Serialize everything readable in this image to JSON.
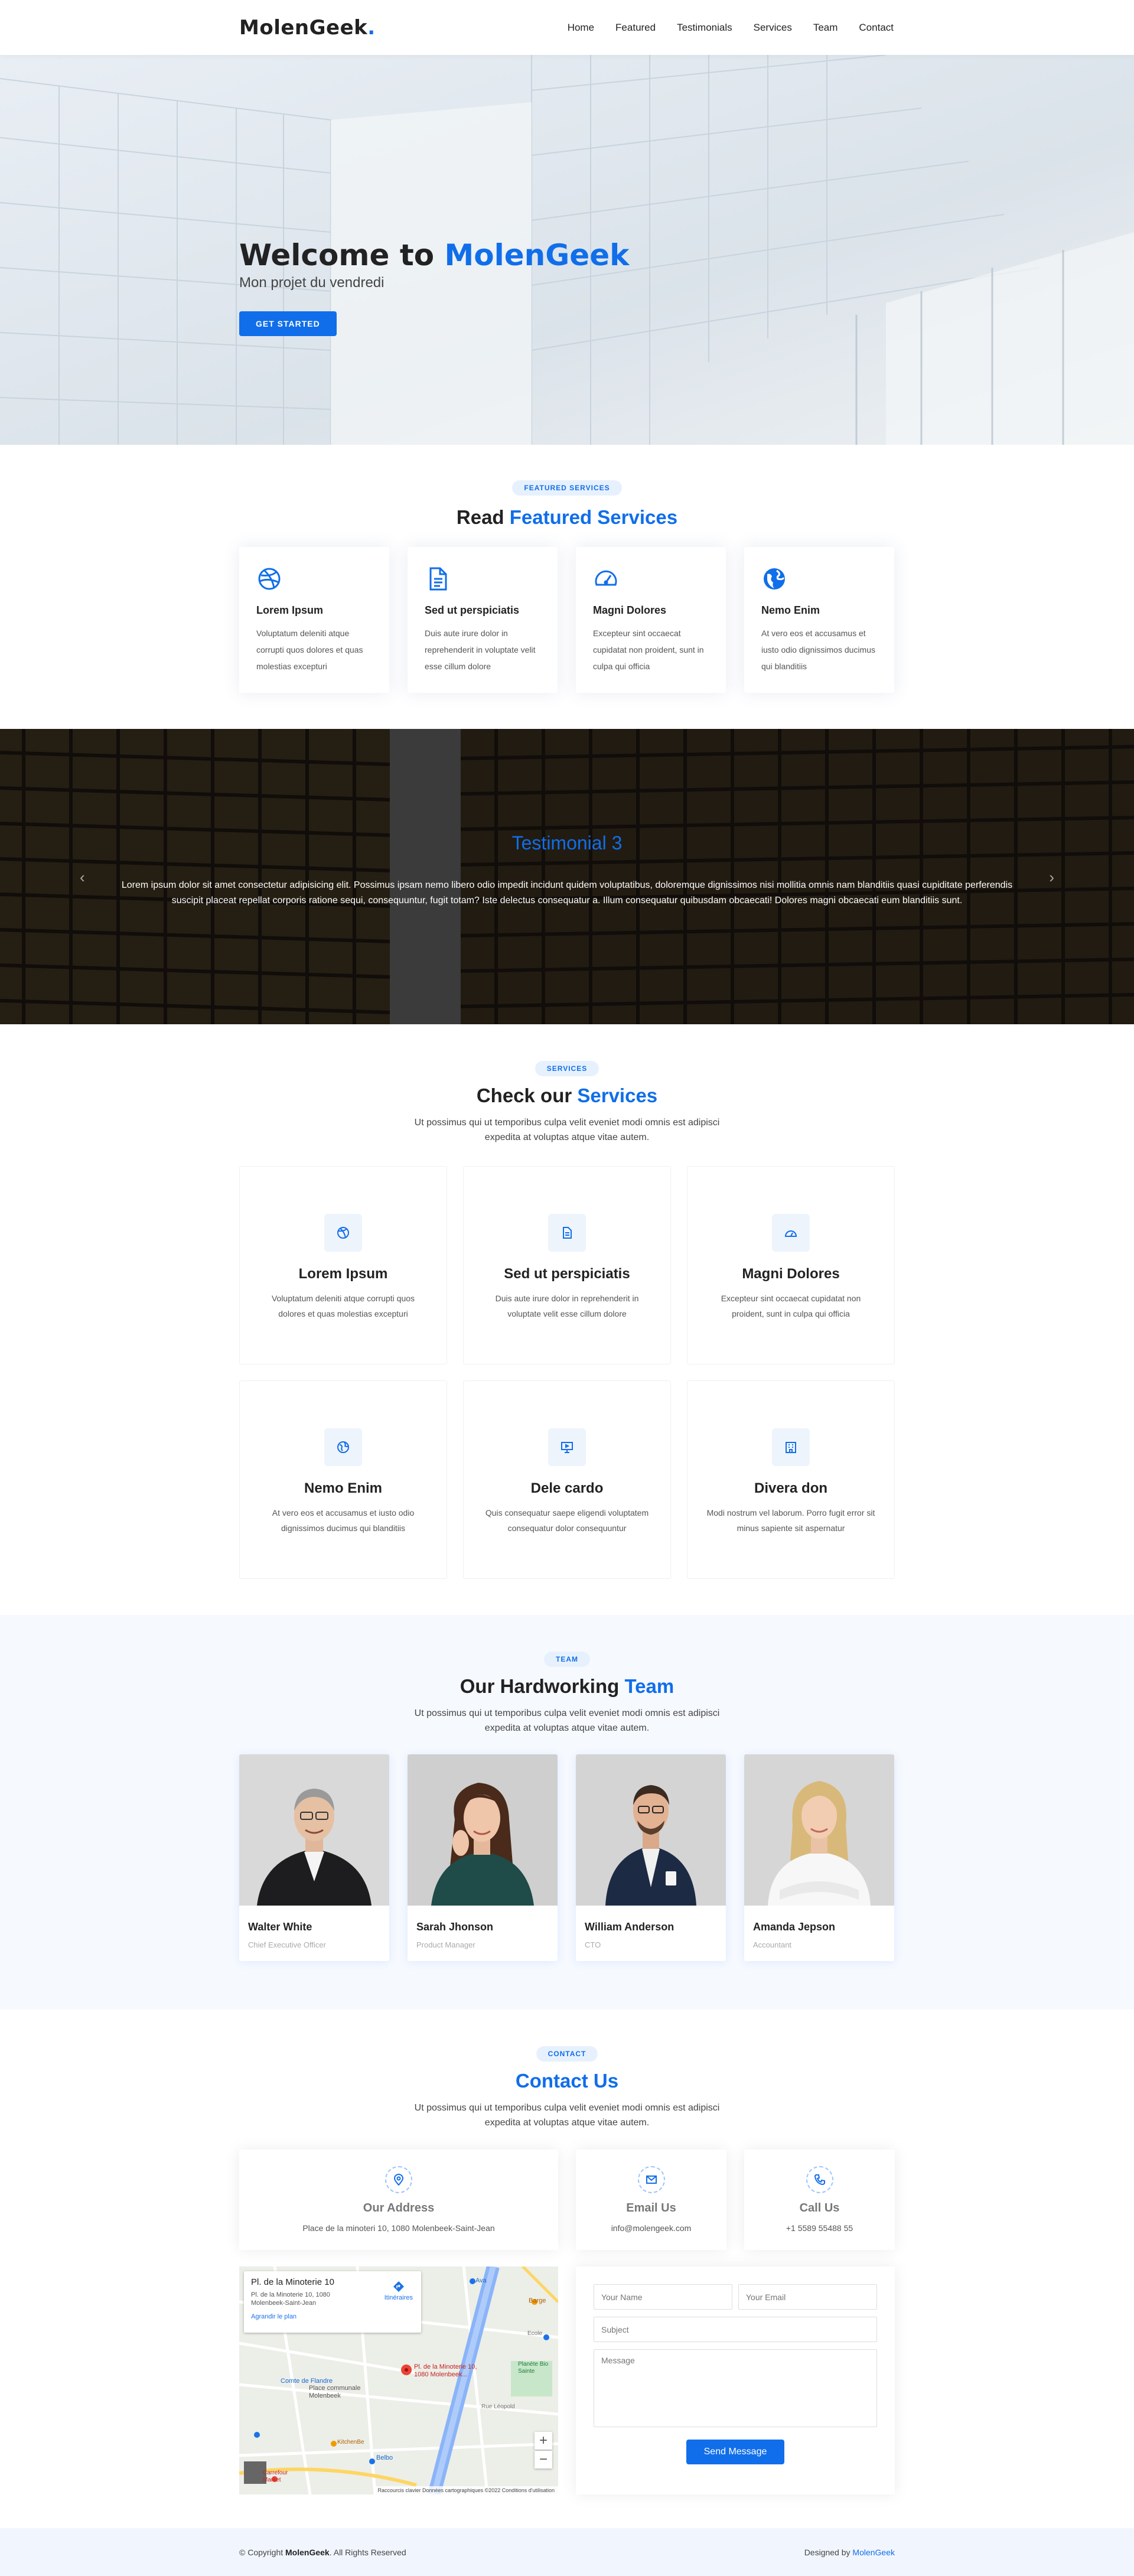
{
  "brand": {
    "name": "MolenGeek",
    "dot": "."
  },
  "nav": {
    "items": [
      "Home",
      "Featured",
      "Testimonials",
      "Services",
      "Team",
      "Contact"
    ]
  },
  "hero": {
    "title_prefix": "Welcome to",
    "title_highlight": "MolenGeek",
    "subtitle": "Mon projet du vendredi",
    "cta": "GET STARTED"
  },
  "featured": {
    "badge": "FEATURED SERVICES",
    "title_prefix": "Read",
    "title_highlight": "Featured Services",
    "cards": [
      {
        "icon": "dribbble-icon",
        "title": "Lorem Ipsum",
        "text": "Voluptatum deleniti atque corrupti quos dolores et quas molestias excepturi"
      },
      {
        "icon": "document-icon",
        "title": "Sed ut perspiciatis",
        "text": "Duis aute irure dolor in reprehenderit in voluptate velit esse cillum dolore"
      },
      {
        "icon": "speedometer-icon",
        "title": "Magni Dolores",
        "text": "Excepteur sint occaecat cupidatat non proident, sunt in culpa qui officia"
      },
      {
        "icon": "globe-icon",
        "title": "Nemo Enim",
        "text": "At vero eos et accusamus et iusto odio dignissimos ducimus qui blanditiis"
      }
    ]
  },
  "testimonial": {
    "title": "Testimonial 3",
    "text": "Lorem ipsum dolor sit amet consectetur adipisicing elit. Possimus ipsam nemo libero odio impedit incidunt quidem voluptatibus, doloremque dignissimos nisi mollitia omnis nam blanditiis quasi cupiditate perferendis suscipit placeat repellat corporis ratione sequi, consequuntur, fugit totam? Iste delectus consequatur a. Illum consequatur quibusdam obcaecati! Dolores magni obcaecati eum blanditiis sunt.",
    "prev": "‹",
    "next": "›"
  },
  "services": {
    "badge": "SERVICES",
    "title_prefix": "Check our",
    "title_highlight": "Services",
    "intro": "Ut possimus qui ut temporibus culpa velit eveniet modi omnis est adipisci expedita at voluptas atque vitae autem.",
    "cards": [
      {
        "icon": "dribbble-icon",
        "title": "Lorem Ipsum",
        "text": "Voluptatum deleniti atque corrupti quos dolores et quas molestias excepturi"
      },
      {
        "icon": "file-icon",
        "title": "Sed ut perspiciatis",
        "text": "Duis aute irure dolor in reprehenderit in voluptate velit esse cillum dolore"
      },
      {
        "icon": "cloud-icon",
        "title": "Magni Dolores",
        "text": "Excepteur sint occaecat cupidatat non proident, sunt in culpa qui officia"
      },
      {
        "icon": "globe-icon",
        "title": "Nemo Enim",
        "text": "At vero eos et accusamus et iusto odio dignissimos ducimus qui blanditiis"
      },
      {
        "icon": "slideshow-icon",
        "title": "Dele cardo",
        "text": "Quis consequatur saepe eligendi voluptatem consequatur dolor consequuntur"
      },
      {
        "icon": "building-icon",
        "title": "Divera don",
        "text": "Modi nostrum vel laborum. Porro fugit error sit minus sapiente sit aspernatur"
      }
    ]
  },
  "team": {
    "badge": "TEAM",
    "title_prefix": "Our Hardworking",
    "title_highlight": "Team",
    "intro": "Ut possimus qui ut temporibus culpa velit eveniet modi omnis est adipisci expedita at voluptas atque vitae autem.",
    "members": [
      {
        "name": "Walter White",
        "role": "Chief Executive Officer"
      },
      {
        "name": "Sarah Jhonson",
        "role": "Product Manager"
      },
      {
        "name": "William Anderson",
        "role": "CTO"
      },
      {
        "name": "Amanda Jepson",
        "role": "Accountant"
      }
    ]
  },
  "contact": {
    "badge": "CONTACT",
    "title": "Contact Us",
    "intro": "Ut possimus qui ut temporibus culpa velit eveniet modi omnis est adipisci expedita at voluptas atque vitae autem.",
    "address": {
      "title": "Our Address",
      "value": "Place de la minoteri 10, 1080 Molenbeek-Saint-Jean"
    },
    "email": {
      "title": "Email Us",
      "value": "info@molengeek.com"
    },
    "phone": {
      "title": "Call Us",
      "value": "+1 5589 55488 55"
    },
    "map": {
      "place": "Pl. de la Minoterie 10",
      "address": "Pl. de la Minoterie 10, 1080 Molenbeek-Saint-Jean",
      "enlarge": "Agrandir le plan",
      "directions": "Itinéraires",
      "pin_label": "Pl. de la Minoterie 10, 1080 Molenbeek...",
      "label_comte": "Comte de Flandre",
      "label_place": "Place communale Molenbeek",
      "label_belbo": "Belbo",
      "label_rue": "Rue Léopold",
      "label_ava": "Ava",
      "label_barge": "Barge",
      "label_planete": "Planète Bio Sainte",
      "label_ecole": "Ecole",
      "label_carrefour": "Carrefour Market",
      "label_kitchen": "KitchenBe",
      "label_zoom_in": "+",
      "label_zoom_out": "−",
      "credits": "Raccourcis clavier   Données cartographiques ©2022   Conditions d'utilisation"
    },
    "form": {
      "name_placeholder": "Your Name",
      "email_placeholder": "Your Email",
      "subject_placeholder": "Subject",
      "message_placeholder": "Message",
      "send": "Send Message"
    }
  },
  "footer": {
    "copyright_prefix": "© Copyright",
    "copyright_brand": "MolenGeek",
    "copyright_suffix": ". All Rights Reserved",
    "designed_prefix": "Designed by",
    "designed_brand": "MolenGeek"
  },
  "colors": {
    "accent": "#106eea",
    "badge_bg": "#e7f1fd",
    "team_bg": "#f6f9fe",
    "footer_bg": "#f1f6fe"
  }
}
